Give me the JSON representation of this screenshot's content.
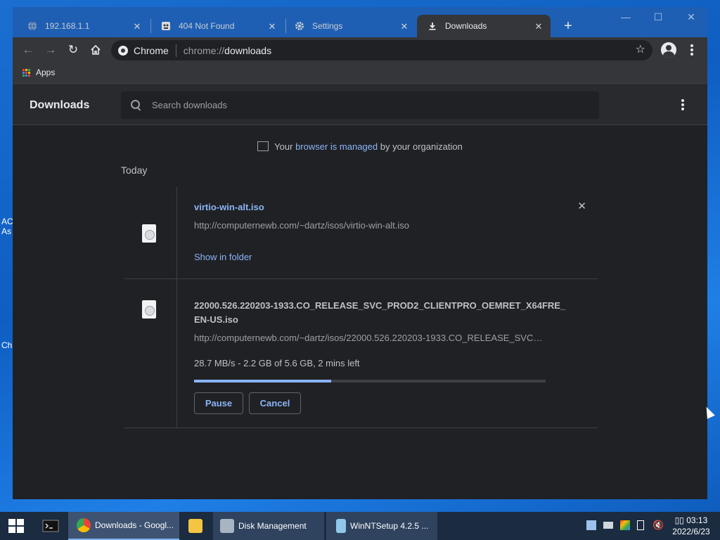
{
  "desktop": {
    "fragments": [
      "AC",
      "As",
      "Ch"
    ]
  },
  "tabs": [
    {
      "title": "192.168.1.1",
      "icon": "globe-icon",
      "active": false
    },
    {
      "title": "404 Not Found",
      "icon": "error-page-icon",
      "active": false
    },
    {
      "title": "Settings",
      "icon": "gear-icon",
      "active": false
    },
    {
      "title": "Downloads",
      "icon": "download-icon",
      "active": true
    }
  ],
  "window_controls": {
    "minimize": "—",
    "maximize": "☐",
    "close": "✕"
  },
  "omnibox": {
    "badge": "Chrome",
    "scheme": "chrome://",
    "host": "downloads"
  },
  "bookmarks": {
    "apps_label": "Apps"
  },
  "downloads_page": {
    "title": "Downloads",
    "search_placeholder": "Search downloads",
    "managed_prefix": "Your ",
    "managed_link": "browser is managed",
    "managed_suffix": " by your organization",
    "section": "Today",
    "items": [
      {
        "filename": "virtio-win-alt.iso",
        "url": "http://computernewb.com/~dartz/isos/virtio-win-alt.iso",
        "action": "Show in folder"
      },
      {
        "filename_line1": "22000.526.220203-1933.CO_RELEASE_SVC_PROD2_CLIENTPRO_OEMRET_X64FRE_",
        "filename_line2": "EN-US.iso",
        "url": "http://computernewb.com/~dartz/isos/22000.526.220203-1933.CO_RELEASE_SVC_...",
        "status": "28.7 MB/s - 2.2 GB of 5.6 GB, 2 mins left",
        "progress": 0.39,
        "pause_label": "Pause",
        "cancel_label": "Cancel"
      }
    ]
  },
  "taskbar": {
    "apps": [
      {
        "label": "Downloads - Googl...",
        "icon": "chrome-icon"
      },
      {
        "label": "",
        "icon": "file-explorer-icon"
      },
      {
        "label": "Disk Management",
        "icon": "disk-management-icon"
      },
      {
        "label": "WinNTSetup 4.2.5   ...",
        "icon": "winntsetup-icon"
      }
    ],
    "clock_time": "▯▯ 03:13",
    "clock_date": "2022/6/23"
  },
  "colors": {
    "accent": "#8ab4f8",
    "page_bg": "#202124",
    "toolbar_bg": "#35363a",
    "titlebar_bg": "#1e5fb4"
  }
}
